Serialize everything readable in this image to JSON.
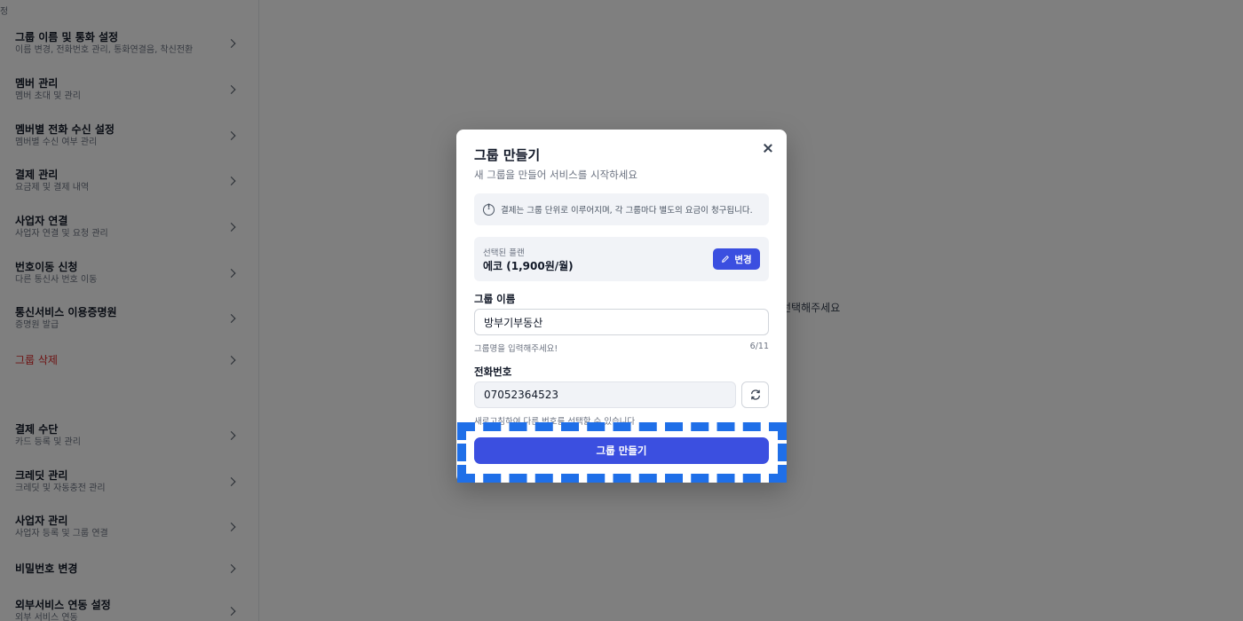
{
  "sidebar": {
    "section_top": "정",
    "section_mid": "",
    "items": [
      {
        "title": "그룹 이름 및 통화 설정",
        "sub": "이름 변경, 전화번호 관리, 통화연결음, 착신전환"
      },
      {
        "title": "멤버 관리",
        "sub": "멤버 초대 및 관리"
      },
      {
        "title": "멤버별 전화 수신 설정",
        "sub": "멤버별 수신 여부 관리"
      },
      {
        "title": "결제 관리",
        "sub": "요금제 및 결제 내역"
      },
      {
        "title": "사업자 연결",
        "sub": "사업자 연결 및 요청 관리"
      },
      {
        "title": "번호이동 신청",
        "sub": "다른 통신사 번호 이동"
      },
      {
        "title": "통신서비스 이용증명원",
        "sub": "증명원 발급"
      },
      {
        "title": "그룹 삭제",
        "sub": ""
      },
      {
        "title": "결제 수단",
        "sub": "카드 등록 및 관리"
      },
      {
        "title": "크레딧 관리",
        "sub": "크레딧 및 자동충전 관리"
      },
      {
        "title": "사업자 관리",
        "sub": "사업자 등록 및 그룹 연결"
      },
      {
        "title": "비밀번호 변경",
        "sub": ""
      },
      {
        "title": "외부서비스 연동 설정",
        "sub": "외부 서비스 연동"
      }
    ]
  },
  "main": {
    "hint": "선택해주세요"
  },
  "modal": {
    "title": "그룹 만들기",
    "subtitle": "새 그룹을 만들어 서비스를 시작하세요",
    "notice": "결제는 그룹 단위로 이루어지며, 각 그룹마다 별도의 요금이 청구됩니다.",
    "plan_label": "선택된 플랜",
    "plan_value": "에코 (1,900원/월)",
    "plan_change": "변경",
    "name_label": "그룹 이름",
    "name_value": "방부기부동산",
    "name_helper": "그룹명을 입력해주세요!",
    "name_count": "6/11",
    "phone_label": "전화번호",
    "phone_value": "07052364523",
    "phone_helper": "새로고침하여 다른 번호를 선택할 수 있습니다",
    "submit": "그룹 만들기"
  },
  "colors": {
    "accent": "#3b4fe0",
    "danger": "#dc2626",
    "highlight": "#1f6fe8"
  }
}
